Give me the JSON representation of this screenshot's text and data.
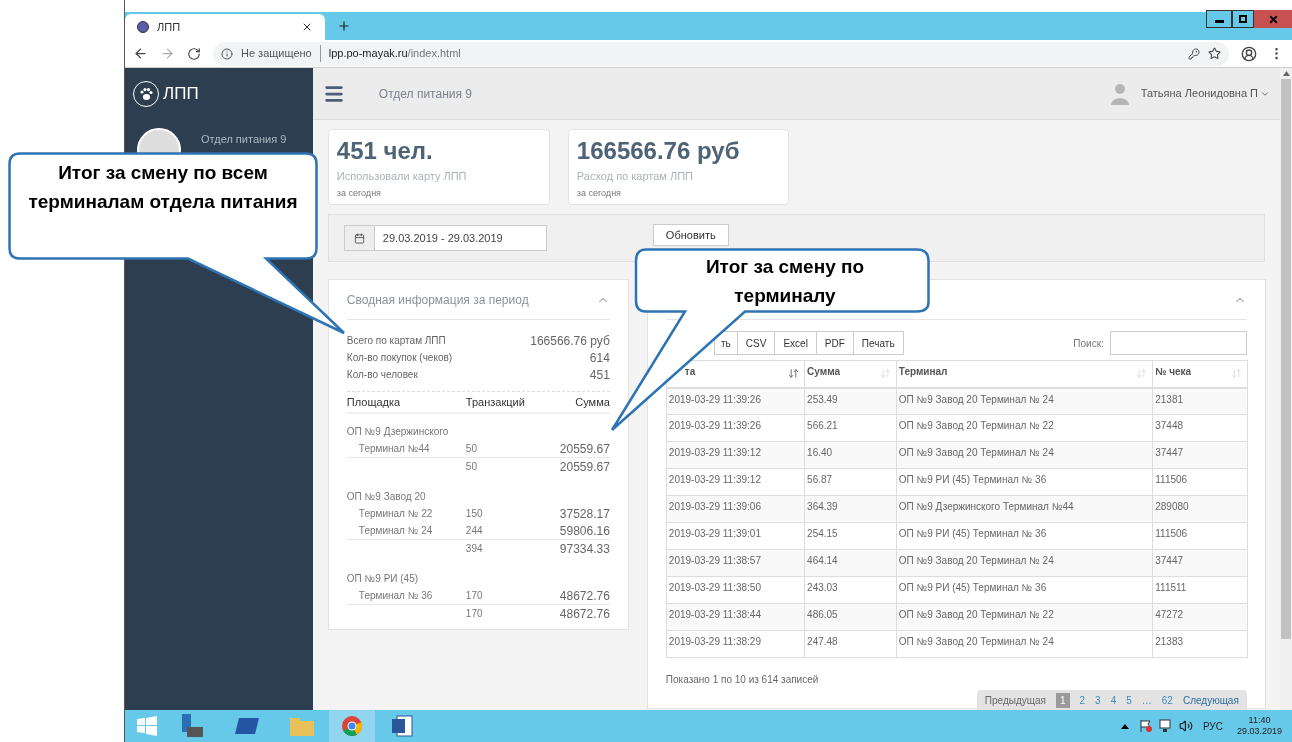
{
  "browser": {
    "tab_title": "ЛПП",
    "security": "Не защищено",
    "url_host": "lpp.po-mayak.ru",
    "url_path": "/index.html"
  },
  "app": {
    "logo": "ЛПП",
    "header_title": "Отдел питания 9",
    "user": "Татьяна Леонидовна П",
    "profile_name": "Отдел питания 9"
  },
  "stats": [
    {
      "value": "451 чел.",
      "label": "Использовали карту ЛПП",
      "sub": "за сегодня"
    },
    {
      "value": "166566.76 руб",
      "label": "Расход по картам ЛПП",
      "sub": "за сегодня"
    }
  ],
  "filter": {
    "date_range": "29.03.2019 - 29.03.2019",
    "button": "Обновить"
  },
  "summary": {
    "title": "Сводная информация за период",
    "expanded": true,
    "totals": [
      {
        "label": "Всего по картам ЛПП",
        "value": "166566.76 руб"
      },
      {
        "label": "Кол-во покупок (чеков)",
        "value": "614"
      },
      {
        "label": "Кол-во человек",
        "value": "451"
      }
    ],
    "columns": [
      "Площадка",
      "Транзакций",
      "Сумма"
    ],
    "groups": [
      {
        "name": "ОП №9 Дзержинского",
        "terminals": [
          {
            "name": "Терминал №44",
            "count": "50",
            "sum": "20559.67"
          }
        ],
        "total_count": "50",
        "total_sum": "20559.67"
      },
      {
        "name": "ОП №9 Завод 20",
        "terminals": [
          {
            "name": "Терминал № 22",
            "count": "150",
            "sum": "37528.17"
          },
          {
            "name": "Терминал № 24",
            "count": "244",
            "sum": "59806.16"
          }
        ],
        "total_count": "394",
        "total_sum": "97334.33"
      },
      {
        "name": "ОП №9 РИ (45)",
        "terminals": [
          {
            "name": "Терминал № 36",
            "count": "170",
            "sum": "48672.76"
          }
        ],
        "total_count": "170",
        "total_sum": "48672.76"
      }
    ]
  },
  "transactions": {
    "expanded": true,
    "buttons": [
      "ть",
      "CSV",
      "Excel",
      "PDF",
      "Печать"
    ],
    "search_label": "Поиск:",
    "columns": [
      {
        "label": "та",
        "sorted": true
      },
      {
        "label": "Сумма",
        "sorted": false
      },
      {
        "label": "Терминал",
        "sorted": false
      },
      {
        "label": "№ чека",
        "sorted": false
      }
    ],
    "rows": [
      [
        "2019-03-29 11:39:26",
        "253.49",
        "ОП №9 Завод 20 Терминал № 24",
        "21381"
      ],
      [
        "2019-03-29 11:39:26",
        "566.21",
        "ОП №9 Завод 20 Терминал № 22",
        "37448"
      ],
      [
        "2019-03-29 11:39:12",
        "16.40",
        "ОП №9 Завод 20 Терминал № 24",
        "37447"
      ],
      [
        "2019-03-29 11:39:12",
        "56.87",
        "ОП №9 РИ (45) Терминал № 36",
        "111506"
      ],
      [
        "2019-03-29 11:39:06",
        "364.39",
        "ОП №9 Дзержинского Терминал №44",
        "289080"
      ],
      [
        "2019-03-29 11:39:01",
        "254.15",
        "ОП №9 РИ (45) Терминал № 36",
        "111506"
      ],
      [
        "2019-03-29 11:38:57",
        "464.14",
        "ОП №9 Завод 20 Терминал № 24",
        "37447"
      ],
      [
        "2019-03-29 11:38:50",
        "243.03",
        "ОП №9 РИ (45) Терминал № 36",
        "111511"
      ],
      [
        "2019-03-29 11:38:44",
        "486.05",
        "ОП №9 Завод 20 Терминал № 22",
        "47272"
      ],
      [
        "2019-03-29 11:38:29",
        "247.48",
        "ОП №9 Завод 20 Терминал № 24",
        "21383"
      ]
    ],
    "info": "Показано 1 по 10 из 614 записей",
    "pagination": {
      "prev": "Предыдущая",
      "next": "Следующая",
      "pages": [
        {
          "label": "1",
          "selected": true
        },
        {
          "label": "2",
          "selected": false
        },
        {
          "label": "3",
          "selected": false
        },
        {
          "label": "4",
          "selected": false
        },
        {
          "label": "5",
          "selected": false
        },
        {
          "label": "…",
          "selected": false
        },
        {
          "label": "62",
          "selected": false
        }
      ]
    }
  },
  "taskbar": {
    "language": "РУС",
    "time": "11:40",
    "date": "29.03.2019"
  },
  "callouts": [
    {
      "text": "Итог за смену по всем терминалам отдела питания"
    },
    {
      "text": "Итог за смену по терминалу"
    }
  ]
}
